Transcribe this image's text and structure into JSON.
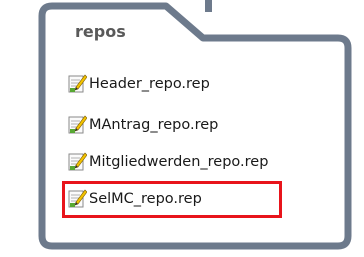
{
  "folder": {
    "title": "repos",
    "files": [
      {
        "label": "Header_repo.rep",
        "icon": "rep-file-icon",
        "highlighted": false
      },
      {
        "label": "MAntrag_repo.rep",
        "icon": "rep-file-icon",
        "highlighted": false
      },
      {
        "label": "Mitgliedwerden_repo.rep",
        "icon": "rep-file-icon",
        "highlighted": false
      },
      {
        "label": "SelMC_repo.rep",
        "icon": "rep-file-icon",
        "highlighted": true
      }
    ]
  },
  "colors": {
    "folder_border": "#6d7a8c",
    "folder_fill": "#ffffff",
    "highlight": "#e8141b",
    "text": "#1a1a1a",
    "title": "#595959"
  }
}
